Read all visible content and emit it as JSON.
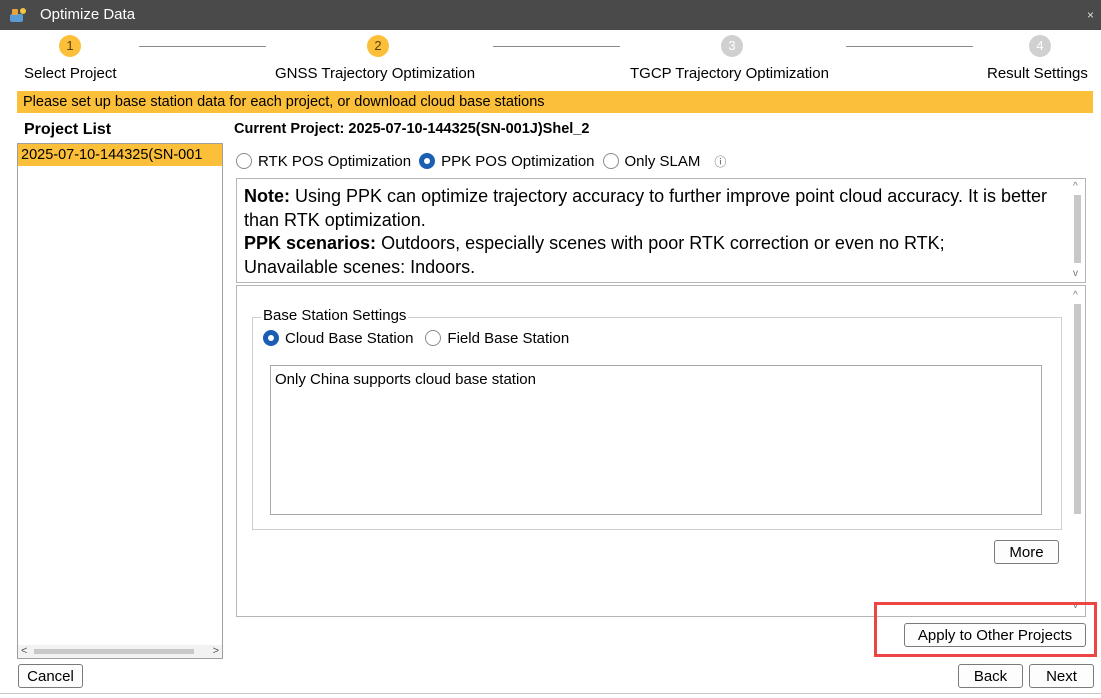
{
  "window": {
    "title": "Optimize Data",
    "close_glyph": "×",
    "app_icon": "app-logo-icon"
  },
  "steps": [
    {
      "number": "1",
      "label": "Select Project",
      "state": "active"
    },
    {
      "number": "2",
      "label": "GNSS Trajectory Optimization",
      "state": "active"
    },
    {
      "number": "3",
      "label": "TGCP Trajectory Optimization",
      "state": "inactive"
    },
    {
      "number": "4",
      "label": "Result Settings",
      "state": "inactive"
    }
  ],
  "banner": {
    "text": "Please set up base station data for each project, or download cloud base stations"
  },
  "project_list": {
    "title": "Project List",
    "items": [
      "2025-07-10-144325(SN-001"
    ],
    "scroll_left": "<",
    "scroll_right": ">"
  },
  "current_project": {
    "label": "Current Project: 2025-07-10-144325(SN-001J)Shel_2"
  },
  "optimization_modes": {
    "options": [
      "RTK POS Optimization",
      "PPK POS Optimization",
      "Only SLAM"
    ],
    "selected": "PPK POS Optimization",
    "info_glyph": "ⓘ"
  },
  "note": {
    "note_label": "Note:",
    "note_text": " Using PPK can optimize trajectory accuracy to further improve point cloud accuracy. It is better than RTK optimization.",
    "scenarios_label": "PPK scenarios:",
    "scenarios_text": " Outdoors, especially scenes with poor RTK correction or even no RTK;",
    "unavailable_text": "Unavailable scenes: Indoors."
  },
  "base_station": {
    "group_title": "Base Station Settings",
    "options": [
      "Cloud Base Station",
      "Field Base Station"
    ],
    "selected": "Cloud Base Station",
    "message": "Only China supports cloud base station",
    "more_label": "More"
  },
  "buttons": {
    "apply_label": "Apply to Other Projects",
    "cancel_label": "Cancel",
    "back_label": "Back",
    "next_label": "Next"
  },
  "colors": {
    "accent": "#fbbf3a",
    "radio_checked": "#1a5fb4",
    "highlight": "#ef4444",
    "titlebar": "#4a4a4a"
  }
}
